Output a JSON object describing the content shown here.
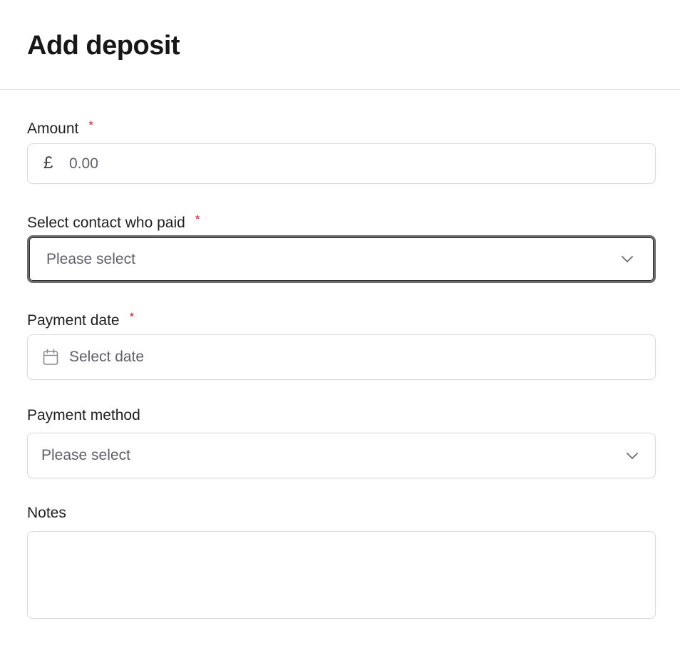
{
  "header": {
    "title": "Add deposit"
  },
  "form": {
    "amount": {
      "label": "Amount",
      "required_mark": "*",
      "currency_symbol": "£",
      "placeholder": "0.00",
      "value": ""
    },
    "contact": {
      "label": "Select contact who paid",
      "required_mark": "*",
      "selected": "Please select"
    },
    "payment_date": {
      "label": "Payment date",
      "required_mark": "*",
      "placeholder": "Select date",
      "icon": "calendar-icon"
    },
    "payment_method": {
      "label": "Payment method",
      "selected": "Please select"
    },
    "notes": {
      "label": "Notes",
      "value": ""
    }
  },
  "colors": {
    "required": "#c0262d",
    "border": "#d9d9de",
    "focus_border": "#6b6b6b",
    "placeholder": "#5f5f66"
  }
}
